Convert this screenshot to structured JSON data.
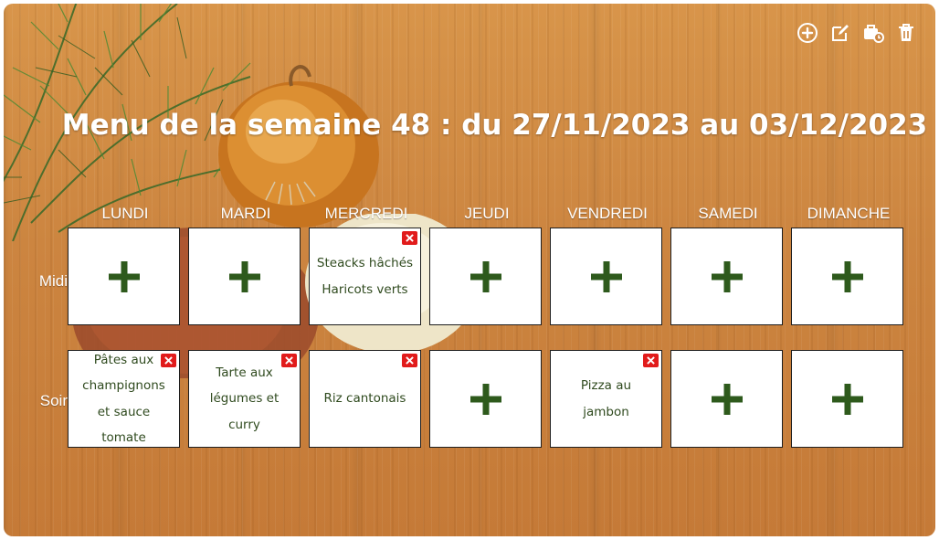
{
  "toolbar": {
    "icons": [
      "add-circle-icon",
      "edit-icon",
      "briefcase-clock-icon",
      "trash-icon"
    ],
    "color": "#ffffff"
  },
  "menu": {
    "title": "Menu de la semaine 48 :  du 27/11/2023 au 03/12/2023"
  },
  "days": [
    "LUNDI",
    "MARDI",
    "MERCREDI",
    "JEUDI",
    "VENDREDI",
    "SAMEDI",
    "DIMANCHE"
  ],
  "rows": [
    {
      "label": "Midi",
      "cells": [
        {
          "meal": null
        },
        {
          "meal": null
        },
        {
          "meal": "Steacks hâchés Haricots verts"
        },
        {
          "meal": null
        },
        {
          "meal": null
        },
        {
          "meal": null
        },
        {
          "meal": null
        }
      ]
    },
    {
      "label": "Soir",
      "cells": [
        {
          "meal": "Pâtes aux champignons et sauce tomate"
        },
        {
          "meal": "Tarte aux légumes et curry"
        },
        {
          "meal": "Riz cantonais"
        },
        {
          "meal": null
        },
        {
          "meal": "Pizza au jambon"
        },
        {
          "meal": null
        },
        {
          "meal": null
        }
      ]
    }
  ],
  "colors": {
    "plus": "#2e5a1c",
    "meal_text": "#2f4a1e",
    "delete_badge": "#e11b1b",
    "cell_border": "#1e1e1e"
  }
}
